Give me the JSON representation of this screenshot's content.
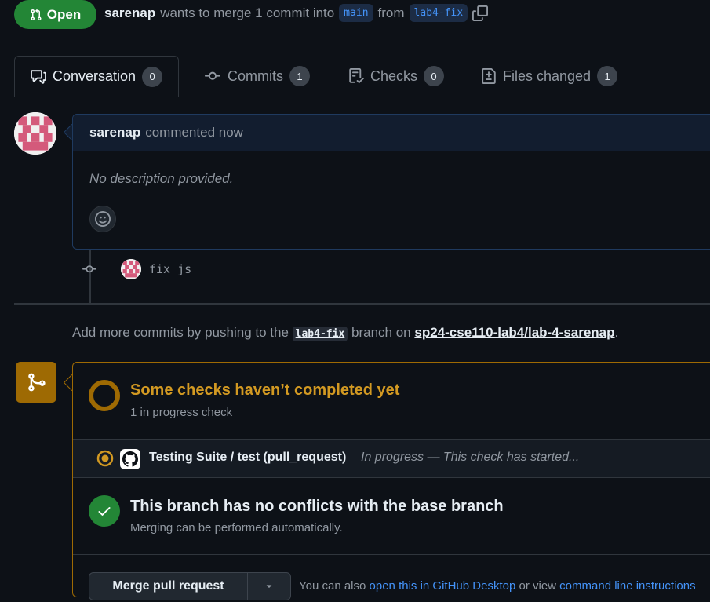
{
  "header": {
    "state": "Open",
    "author": "sarenap",
    "summary_pre": "wants to merge 1 commit into",
    "base_branch": "main",
    "from_word": "from",
    "head_branch": "lab4-fix"
  },
  "tabs": [
    {
      "label": "Conversation",
      "count": "0"
    },
    {
      "label": "Commits",
      "count": "1"
    },
    {
      "label": "Checks",
      "count": "0"
    },
    {
      "label": "Files changed",
      "count": "1"
    }
  ],
  "comment": {
    "author": "sarenap",
    "action": "commented now",
    "body": "No description provided."
  },
  "commit": {
    "message": "fix js"
  },
  "push_hint": {
    "pre": "Add more commits by pushing to the",
    "branch": "lab4-fix",
    "mid": "branch on",
    "repo": "sp24-cse110-lab4/lab-4-sarenap",
    "post": "."
  },
  "checks": {
    "title": "Some checks haven’t completed yet",
    "subtitle": "1 in progress check",
    "run_name": "Testing Suite / test (pull_request)",
    "run_status": "In progress — This check has started..."
  },
  "conflicts": {
    "title": "This branch has no conflicts with the base branch",
    "subtitle": "Merging can be performed automatically."
  },
  "merge": {
    "button": "Merge pull request",
    "alt_pre": "You can also",
    "alt_link1": "open this in GitHub Desktop",
    "alt_mid": "or view",
    "alt_link2": "command line instructions"
  },
  "colors": {
    "open": "#238636",
    "pending": "#9e6a03",
    "link": "#4493f8"
  }
}
